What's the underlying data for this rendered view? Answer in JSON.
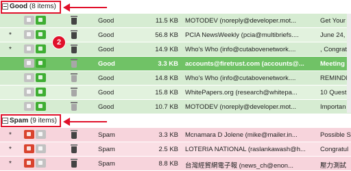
{
  "groups": {
    "good": {
      "name": "Good",
      "count_label": "(8 items)",
      "rows": [
        {
          "star": "",
          "classification": "Good",
          "size": "11.5 KB",
          "from": "MOTODEV (noreply@developer.mot...",
          "subject": "Get Your"
        },
        {
          "star": "*",
          "classification": "Good",
          "size": "56.8 KB",
          "from": "PCIA NewsWeekly (pcia@multibriefs....",
          "subject": "June 24, 2"
        },
        {
          "star": "*",
          "classification": "Good",
          "size": "14.9 KB",
          "from": "Who's Who (info@cutabovenetwork....",
          "subject": ", Congratu"
        },
        {
          "star": "",
          "classification": "Good",
          "size": "3.3 KB",
          "from": "accounts@firetrust.com (accounts@...",
          "subject": "Meeting r"
        },
        {
          "star": "",
          "classification": "Good",
          "size": "14.8 KB",
          "from": "Who's Who (info@cutabovenetwork....",
          "subject": "REMINDE"
        },
        {
          "star": "",
          "classification": "Good",
          "size": "15.8 KB",
          "from": "WhitePapers.org (research@whitepa...",
          "subject": "10 Questi"
        },
        {
          "star": "",
          "classification": "Good",
          "size": "10.7 KB",
          "from": "MOTODEV (noreply@developer.mot...",
          "subject": "Importan"
        }
      ]
    },
    "spam": {
      "name": "Spam",
      "count_label": "(9 items)",
      "rows": [
        {
          "star": "*",
          "classification": "Spam",
          "size": "3.3 KB",
          "from": "Mcnamara D Jolene (mike@mailer.in...",
          "subject": "Possible S"
        },
        {
          "star": "*",
          "classification": "Spam",
          "size": "2.5 KB",
          "from": "LOTERIA NATIONAL (raslankawash@h...",
          "subject": "Congratul"
        },
        {
          "star": "*",
          "classification": "Spam",
          "size": "8.8 KB",
          "from": "台灣經貿網電子報 (news_ch@enon...",
          "subject": "壓力測試"
        }
      ]
    }
  },
  "callout_badge": "2",
  "colors": {
    "good_row": "#d6ecd2",
    "good_selected": "#70c266",
    "spam_row": "#f7d4dc",
    "annotation_red": "#e0102a"
  },
  "icons": [
    "thumbs-down-icon",
    "thumbs-up-icon",
    "trash-icon",
    "collapse-icon"
  ]
}
